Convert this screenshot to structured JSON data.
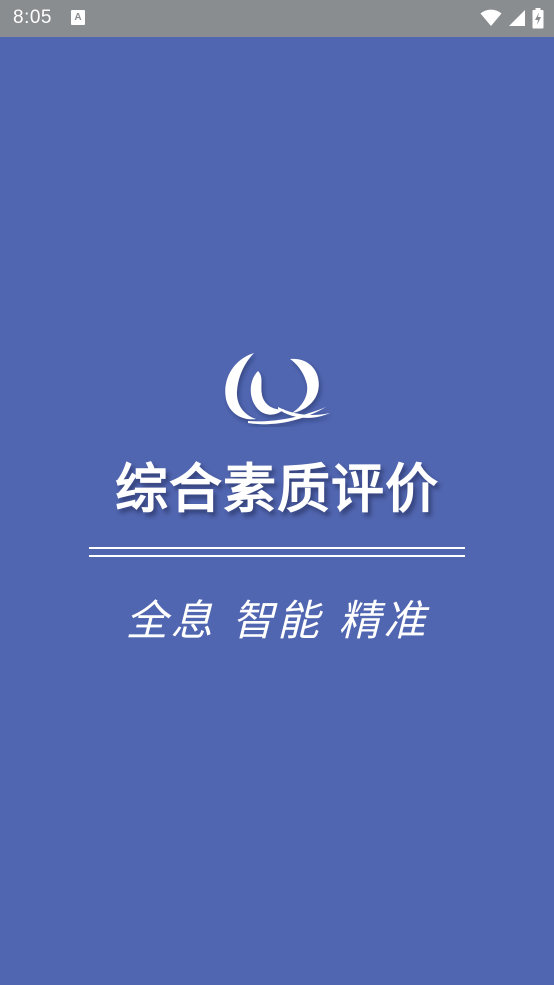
{
  "status_bar": {
    "time": "8:05",
    "notification_badge": "A",
    "icons": [
      "wifi-icon",
      "signal-icon",
      "battery-charging-icon"
    ]
  },
  "splash": {
    "title": "综合素质评价",
    "slogan": "全息 智能 精准",
    "logo_icon": "swirl-q-logo-icon"
  },
  "colors": {
    "background": "#5166b0",
    "status_bar": "#8a8d90",
    "text": "#ffffff"
  }
}
